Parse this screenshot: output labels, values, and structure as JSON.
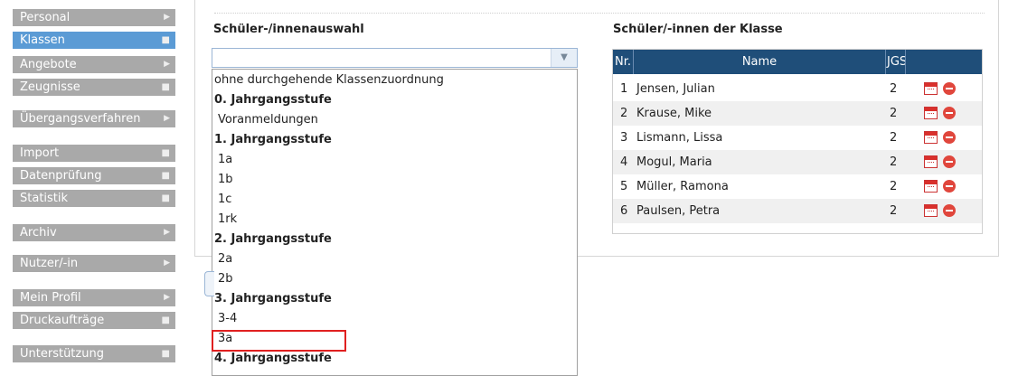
{
  "sidebar": {
    "items": [
      {
        "label": "Personal",
        "marker": "arrow"
      },
      {
        "label": "Klassen",
        "marker": "square",
        "active": true
      },
      {
        "label": "Angebote",
        "marker": "arrow"
      },
      {
        "label": "Zeugnisse",
        "marker": "square"
      },
      {
        "label": "Übergangsverfahren",
        "marker": "arrow"
      },
      {
        "label": "Import",
        "marker": "square"
      },
      {
        "label": "Datenprüfung",
        "marker": "square"
      },
      {
        "label": "Statistik",
        "marker": "square"
      },
      {
        "label": "Archiv",
        "marker": "arrow"
      },
      {
        "label": "Nutzer/-in",
        "marker": "arrow"
      },
      {
        "label": "Mein Profil",
        "marker": "arrow"
      },
      {
        "label": "Druckaufträge",
        "marker": "square"
      },
      {
        "label": "Unterstützung",
        "marker": "square"
      }
    ]
  },
  "selection": {
    "title": "Schüler-/innenauswahl",
    "value": "",
    "options": [
      {
        "label": "ohne durchgehende Klassenzuordnung",
        "type": "first"
      },
      {
        "label": "0. Jahrgangsstufe",
        "type": "group"
      },
      {
        "label": "Voranmeldungen",
        "type": "item"
      },
      {
        "label": "1. Jahrgangsstufe",
        "type": "group"
      },
      {
        "label": "1a",
        "type": "item"
      },
      {
        "label": "1b",
        "type": "item"
      },
      {
        "label": "1c",
        "type": "item"
      },
      {
        "label": "1rk",
        "type": "item"
      },
      {
        "label": "2. Jahrgangsstufe",
        "type": "group"
      },
      {
        "label": "2a",
        "type": "item"
      },
      {
        "label": "2b",
        "type": "item"
      },
      {
        "label": "3. Jahrgangsstufe",
        "type": "group"
      },
      {
        "label": "3-4",
        "type": "item"
      },
      {
        "label": "3a",
        "type": "item",
        "highlighted": true
      },
      {
        "label": "4. Jahrgangsstufe",
        "type": "group"
      }
    ]
  },
  "class_table": {
    "title": "Schüler/-innen der Klasse",
    "headers": {
      "nr": "Nr.",
      "name": "Name",
      "jgs": "JGS"
    },
    "rows": [
      {
        "nr": "1",
        "name": "Jensen, Julian",
        "jgs": "2"
      },
      {
        "nr": "2",
        "name": "Krause, Mike",
        "jgs": "2"
      },
      {
        "nr": "3",
        "name": "Lismann, Lissa",
        "jgs": "2"
      },
      {
        "nr": "4",
        "name": "Mogul, Maria",
        "jgs": "2"
      },
      {
        "nr": "5",
        "name": "Müller, Ramona",
        "jgs": "2"
      },
      {
        "nr": "6",
        "name": "Paulsen, Petra",
        "jgs": "2"
      }
    ]
  },
  "icons": {
    "calendar": "calendar-icon",
    "remove": "remove-icon",
    "chevron": "chevron-down-icon"
  },
  "colors": {
    "active_nav": "#5b9bd5",
    "nav": "#a9a9a9",
    "table_header": "#1f4e79",
    "highlight": "#e02020"
  }
}
